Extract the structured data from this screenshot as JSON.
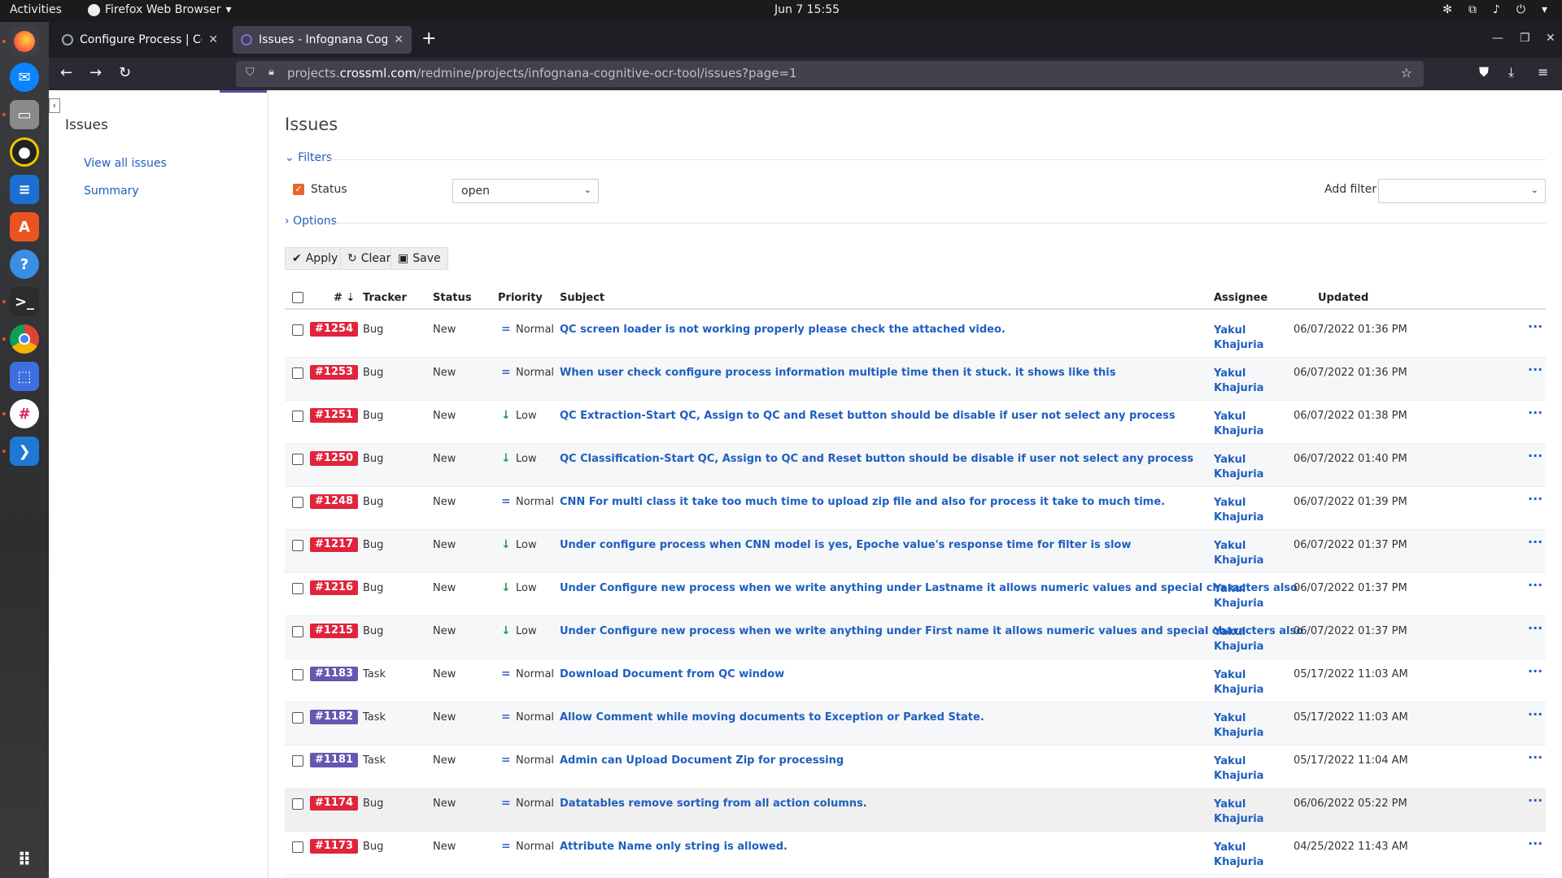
{
  "topbar": {
    "activities": "Activities",
    "app_name": "Firefox Web Browser",
    "clock": "Jun 7  15:55"
  },
  "tabs": [
    {
      "title": "Configure Process | Cogn",
      "active": false
    },
    {
      "title": "Issues - Infognana Cognit",
      "active": true
    }
  ],
  "url": {
    "prefix": "projects.",
    "domain": "crossml.com",
    "path": "/redmine/projects/infognana-cognitive-ocr-tool/issues?page=1"
  },
  "sidebar": {
    "title": "Issues",
    "links": [
      "View all issues",
      "Summary"
    ]
  },
  "main": {
    "title": "Issues",
    "filters_legend": "Filters",
    "status_label": "Status",
    "status_value": "open",
    "add_filter_label": "Add filter",
    "options_legend": "Options",
    "buttons": {
      "apply": "Apply",
      "clear": "Clear",
      "save": "Save"
    }
  },
  "table": {
    "headers": {
      "id": "#",
      "tracker": "Tracker",
      "status": "Status",
      "priority": "Priority",
      "subject": "Subject",
      "assignee": "Assignee",
      "updated": "Updated"
    },
    "rows": [
      {
        "id": "#1254",
        "tracker": "Bug",
        "status": "New",
        "priority": "Normal",
        "subject": "QC screen loader is not working properly please check the attached video.",
        "assignee": "Yakul Khajuria",
        "updated": "06/07/2022 01:36 PM"
      },
      {
        "id": "#1253",
        "tracker": "Bug",
        "status": "New",
        "priority": "Normal",
        "subject": "When user check configure process information multiple time then it stuck. it shows like this",
        "assignee": "Yakul Khajuria",
        "updated": "06/07/2022 01:36 PM"
      },
      {
        "id": "#1251",
        "tracker": "Bug",
        "status": "New",
        "priority": "Low",
        "subject": "QC Extraction-Start QC, Assign to QC and Reset button should be disable if user not select any process",
        "assignee": "Yakul Khajuria",
        "updated": "06/07/2022 01:38 PM"
      },
      {
        "id": "#1250",
        "tracker": "Bug",
        "status": "New",
        "priority": "Low",
        "subject": "QC Classification-Start QC, Assign to QC and Reset button should be disable if user not select any process",
        "assignee": "Yakul Khajuria",
        "updated": "06/07/2022 01:40 PM"
      },
      {
        "id": "#1248",
        "tracker": "Bug",
        "status": "New",
        "priority": "Normal",
        "subject": "CNN For multi class it take too much time to upload zip file and also for process it take to much time.",
        "assignee": "Yakul Khajuria",
        "updated": "06/07/2022 01:39 PM"
      },
      {
        "id": "#1217",
        "tracker": "Bug",
        "status": "New",
        "priority": "Low",
        "subject": "Under configure process when CNN model is yes, Epoche value's response time for filter is slow",
        "assignee": "Yakul Khajuria",
        "updated": "06/07/2022 01:37 PM"
      },
      {
        "id": "#1216",
        "tracker": "Bug",
        "status": "New",
        "priority": "Low",
        "subject": "Under Configure new process when we write anything under Lastname it allows numeric values and special characters also",
        "assignee": "Yakul Khajuria",
        "updated": "06/07/2022 01:37 PM"
      },
      {
        "id": "#1215",
        "tracker": "Bug",
        "status": "New",
        "priority": "Low",
        "subject": "Under Configure new process when we write anything under First name it allows numeric values and special characters also",
        "assignee": "Yakul Khajuria",
        "updated": "06/07/2022 01:37 PM"
      },
      {
        "id": "#1183",
        "tracker": "Task",
        "status": "New",
        "priority": "Normal",
        "subject": "Download Document from QC window",
        "assignee": "Yakul Khajuria",
        "updated": "05/17/2022 11:03 AM"
      },
      {
        "id": "#1182",
        "tracker": "Task",
        "status": "New",
        "priority": "Normal",
        "subject": "Allow Comment while moving documents to Exception or Parked State.",
        "assignee": "Yakul Khajuria",
        "updated": "05/17/2022 11:03 AM"
      },
      {
        "id": "#1181",
        "tracker": "Task",
        "status": "New",
        "priority": "Normal",
        "subject": "Admin can Upload Document Zip for processing",
        "assignee": "Yakul Khajuria",
        "updated": "05/17/2022 11:04 AM"
      },
      {
        "id": "#1174",
        "tracker": "Bug",
        "status": "New",
        "priority": "Normal",
        "subject": "Datatables remove sorting from all action columns.",
        "assignee": "Yakul Khajuria",
        "updated": "06/06/2022 05:22 PM"
      },
      {
        "id": "#1173",
        "tracker": "Bug",
        "status": "New",
        "priority": "Normal",
        "subject": "Attribute Name only string is allowed.",
        "assignee": "Yakul Khajuria",
        "updated": "04/25/2022 11:43 AM"
      }
    ]
  },
  "colors": {
    "bug_badge": "#e0243b",
    "task_badge": "#6657b0",
    "link": "#1f5fbf",
    "low_priority": "#2e9b4a",
    "normal_priority": "#3a6fc4"
  }
}
